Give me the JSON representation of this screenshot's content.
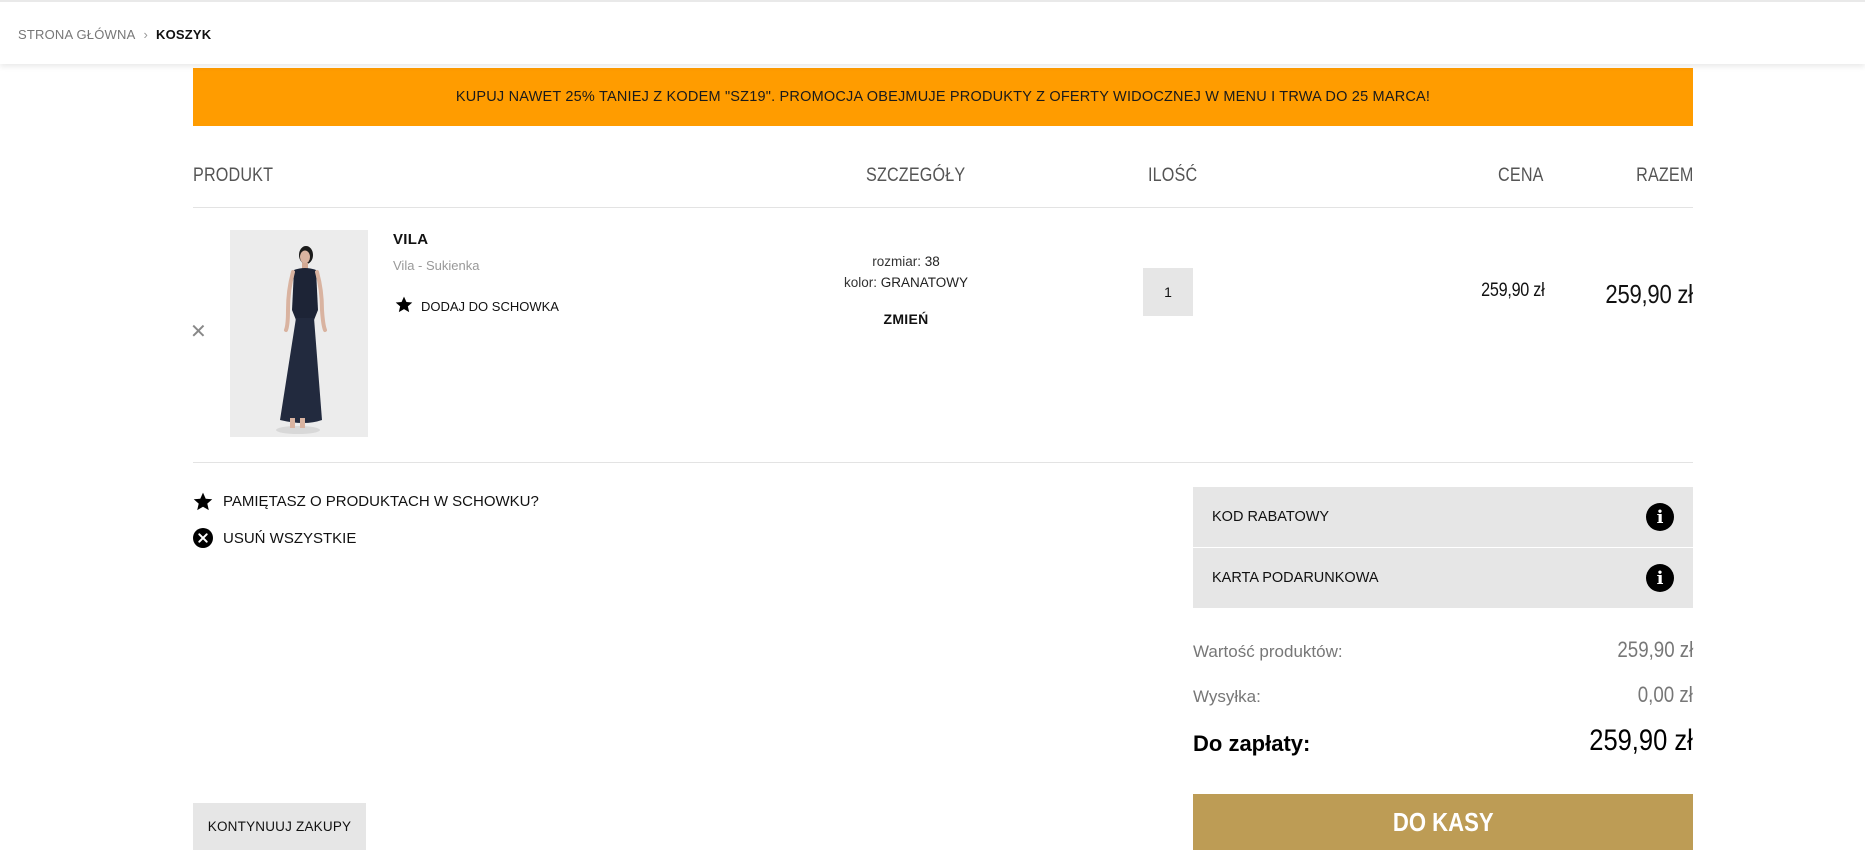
{
  "breadcrumb": {
    "home": "STRONA GŁÓWNA",
    "current": "KOSZYK"
  },
  "promo": {
    "text": "KUPUJ NAWET 25% TANIEJ Z KODEM \"SZ19\". PROMOCJA OBEJMUJE PRODUKTY Z OFERTY WIDOCZNEJ W MENU I TRWA DO 25 MARCA!",
    "color": "#ff9c00"
  },
  "table": {
    "headers": {
      "product": "PRODUKT",
      "details": "SZCZEGÓŁY",
      "quantity": "ILOŚĆ",
      "price": "CENA",
      "total": "RAZEM"
    }
  },
  "item": {
    "brand": "VILA",
    "name": "Vila - Sukienka",
    "wishlist_label": "DODAJ DO SCHOWKA",
    "size_label": "rozmiar:",
    "size_value": "38",
    "color_label": "kolor:",
    "color_value": "GRANATOWY",
    "change_label": "ZMIEŃ",
    "quantity": "1",
    "unit_price": "259,90 zł",
    "row_total": "259,90 zł",
    "image_icon": "dress-photo"
  },
  "actions": {
    "wishlist_reminder": "PAMIĘTASZ O PRODUKTACH W SCHOWKU?",
    "remove_all": "USUŃ WSZYSTKIE"
  },
  "side": {
    "discount_code": "KOD RABATOWY",
    "gift_card": "KARTA PODARUNKOWA"
  },
  "summary": {
    "products_label": "Wartość produktów:",
    "products_value": "259,90 zł",
    "shipping_label": "Wysyłka:",
    "shipping_value": "0,00 zł",
    "total_label": "Do zapłaty:",
    "total_value": "259,90 zł"
  },
  "buttons": {
    "continue": "KONTYNUUJ ZAKUPY",
    "checkout": "DO KASY",
    "checkout_color": "#bd9c55"
  }
}
